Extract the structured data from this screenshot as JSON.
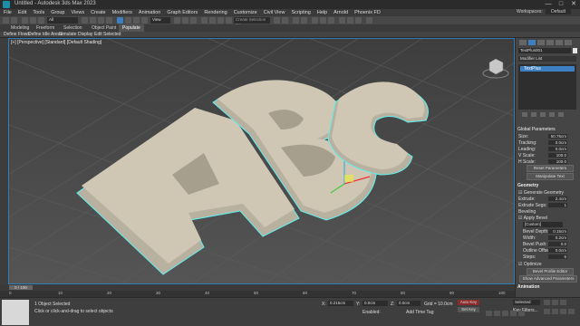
{
  "window": {
    "title": "Untitled - Autodesk 3ds Max 2023",
    "min": "—",
    "max": "□",
    "close": "✕"
  },
  "menus": [
    "File",
    "Edit",
    "Tools",
    "Group",
    "Views",
    "Create",
    "Modifiers",
    "Animation",
    "Graph Editors",
    "Rendering",
    "Customize",
    "Civil View",
    "Scripting",
    "Help",
    "Arnold",
    "Phoenix FD"
  ],
  "menu_right": {
    "workspaces_label": "Workspaces:",
    "workspace_value": "Default"
  },
  "toolbar": {
    "selection_set_placeholder": "Create Selection Se",
    "filter_value": "All",
    "view_value": "View"
  },
  "ribbon_tabs": [
    "Modeling",
    "Freeform",
    "Selection",
    "Object Paint",
    "Populate"
  ],
  "ribbon_active": "Populate",
  "ribbon_sub": [
    "Define Flows",
    "Define Idle Areas",
    "Simulate",
    "Display",
    "Edit Selected"
  ],
  "viewport": {
    "label": "[+] [Perspective] [Standard] [Default Shading]",
    "text": "ABC",
    "accent": "#5ef0f0",
    "object_color": "#cfc7b4"
  },
  "cmd": {
    "object_name": "TextPlus001",
    "modifier_list": "Modifier List",
    "stack_item": "TextPlus",
    "global_params": "Global Parameters",
    "rows": [
      {
        "label": "Size:",
        "value": "50.75cm"
      },
      {
        "label": "Tracking:",
        "value": "0.0cm"
      },
      {
        "label": "Leading:",
        "value": "0.0cm"
      },
      {
        "label": "V Scale:",
        "value": "100.0"
      },
      {
        "label": "H Scale:",
        "value": "100.0"
      }
    ],
    "reset_params": "Reset Parameters",
    "manipulate_text": "Manipulate Text",
    "geometry_head": "Geometry",
    "generate_geometry": "Generate Geometry",
    "extrude_label": "Extrude:",
    "extrude_value": "2.4cm",
    "extrude_segs_label": "Extrude Segs:",
    "extrude_segs_value": "1",
    "beveling": "Beveling",
    "apply_bevel": "Apply Bevel",
    "bevel_preset": "[Custom]",
    "bevel_rows": [
      {
        "label": "Bevel Depth:",
        "value": "0.15cm"
      },
      {
        "label": "Width:",
        "value": "0.2cm"
      },
      {
        "label": "Bevel Push:",
        "value": "0.0"
      },
      {
        "label": "Outline Offset:",
        "value": "0.0cm"
      },
      {
        "label": "Steps:",
        "value": "6"
      }
    ],
    "optimize": "Optimize",
    "bevel_profile_editor": "Bevel Profile Editor",
    "show_advanced": "Show Advanced Parameters",
    "animation_head": "Animation"
  },
  "timeline": {
    "frame": "0 / 100",
    "ticks": [
      "0",
      "10",
      "20",
      "30",
      "40",
      "50",
      "60",
      "70",
      "80",
      "90",
      "100"
    ]
  },
  "status": {
    "selected": "1 Object Selected",
    "prompt": "Click or click-and-drag to select objects",
    "x_label": "X:",
    "x_value": "0.215cm",
    "y_label": "Y:",
    "y_value": "0.0cm",
    "z_label": "Z:",
    "z_value": "0.0cm",
    "grid": "Grid = 10.0cm",
    "enabled": "Enabled:",
    "add_time_tag": "Add Time Tag",
    "set_key": "Set Key",
    "selected_dropdown": "Selected",
    "auto_key": "Auto Key",
    "key_filters": "Key Filters..."
  }
}
